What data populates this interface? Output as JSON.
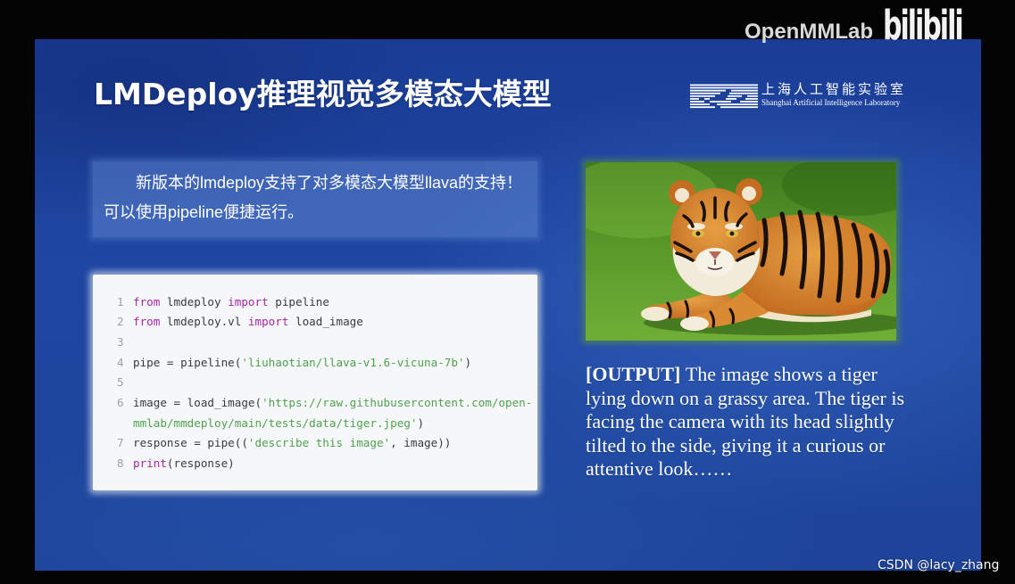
{
  "overlay": {
    "brand": "OpenMMLab",
    "platform_logo": "bilibili",
    "watermark": "CSDN @lacy_zhang"
  },
  "slide": {
    "title": "LMDeploy推理视觉多模态大模型",
    "org_logo": {
      "icon": "sail-stripes-logo",
      "name_zh": "上海人工智能实验室",
      "name_en": "Shanghai Artificial Intelligence Laboratory"
    },
    "intro_lines": [
      "新版本的lmdeploy支持了对多模态大模型llava的支持！",
      "可以使用pipeline便捷运行。"
    ],
    "code": {
      "lines": [
        {
          "n": "1",
          "tokens": [
            {
              "kw": "from"
            },
            {
              "txt": " lmdeploy "
            },
            {
              "kw": "import"
            },
            {
              "txt": " pipeline"
            }
          ]
        },
        {
          "n": "2",
          "tokens": [
            {
              "kw": "from"
            },
            {
              "txt": " lmdeploy.vl "
            },
            {
              "kw": "import"
            },
            {
              "txt": " load_image"
            }
          ]
        },
        {
          "n": "3",
          "tokens": []
        },
        {
          "n": "4",
          "tokens": [
            {
              "txt": "pipe = pipeline("
            },
            {
              "str": "'liuhaotian/llava-v1.6-vicuna-7b'"
            },
            {
              "txt": ")"
            }
          ]
        },
        {
          "n": "5",
          "tokens": []
        },
        {
          "n": "6",
          "tokens": [
            {
              "txt": "image = load_image("
            },
            {
              "str": "'https://raw.githubusercontent.com/open-mmlab/mmdeploy/main/tests/data/tiger.jpeg'"
            },
            {
              "txt": ")"
            }
          ]
        },
        {
          "n": "7",
          "tokens": [
            {
              "txt": "response = pipe(("
            },
            {
              "str": "'describe this image'"
            },
            {
              "txt": ", image))"
            }
          ]
        },
        {
          "n": "8",
          "tokens": [
            {
              "kw": "print"
            },
            {
              "txt": "(response)"
            }
          ]
        }
      ]
    },
    "output": {
      "label": "[OUTPUT]",
      "lines": [
        "The image shows a tiger",
        "lying down on a grassy area. The tiger is",
        "facing the camera with its head slightly",
        "tilted to the side, giving it a curious or",
        "attentive look……"
      ]
    }
  },
  "theme": {
    "slide_bg": "#1f47a2",
    "keyword": "#a626a4",
    "string": "#50a14f",
    "code_text": "#383a42",
    "line_number": "#a0a1a7",
    "code_bg": "#f6f7f9"
  }
}
